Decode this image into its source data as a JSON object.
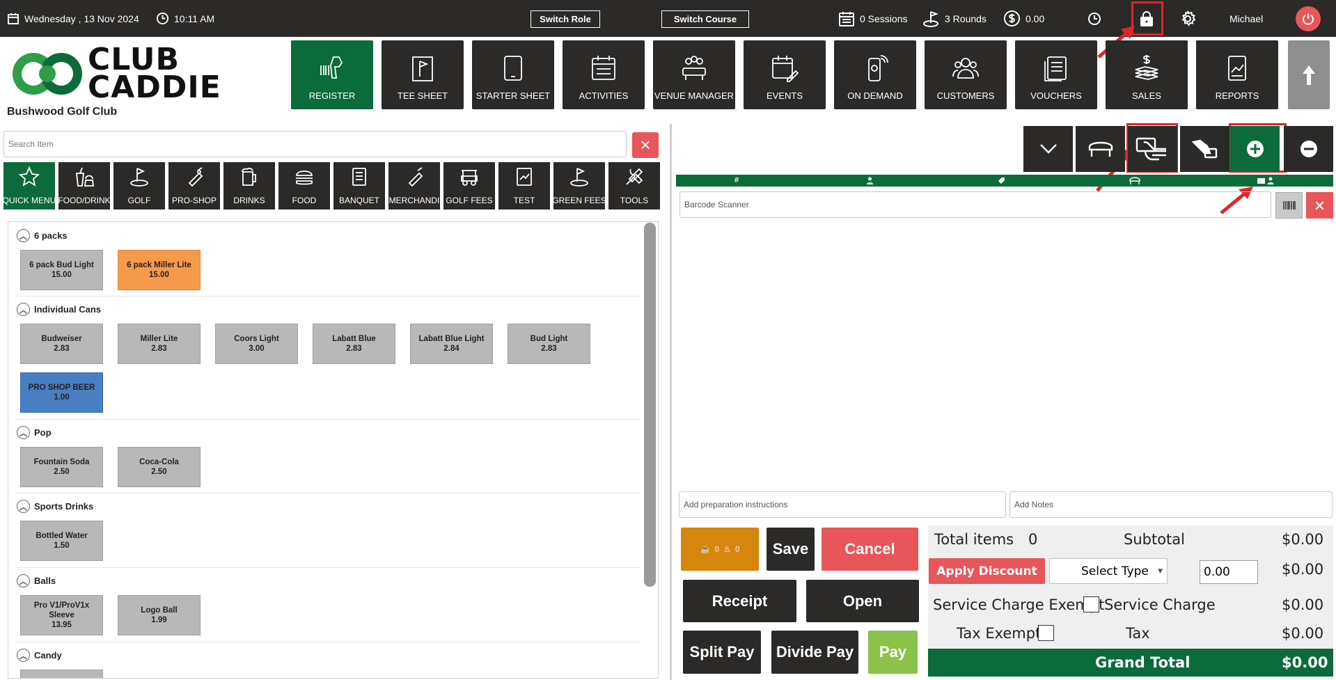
{
  "topbar": {
    "date": "Wednesday ,  13 Nov 2024",
    "time": "10:11 AM",
    "switch_role": "Switch Role",
    "switch_course": "Switch Course",
    "sessions": "0 Sessions",
    "rounds": "3 Rounds",
    "balance": "0.00",
    "user": "Michael"
  },
  "brand": {
    "line1": "CLUB",
    "line2": "CADDIE",
    "club_name": "Bushwood Golf Club"
  },
  "nav": [
    "REGISTER",
    "TEE SHEET",
    "STARTER SHEET",
    "ACTIVITIES",
    "VENUE MANAGER",
    "EVENTS",
    "ON DEMAND",
    "CUSTOMERS",
    "VOUCHERS",
    "SALES",
    "REPORTS"
  ],
  "search": {
    "placeholder": "Search Item"
  },
  "categories": [
    "QUICK MENU",
    "FOOD/DRINK",
    "GOLF",
    "PRO-SHOP",
    "DRINKS",
    "FOOD",
    "BANQUET",
    "MERCHANDI",
    "GOLF FEES",
    "TEST",
    "GREEN FEES",
    "TOOLS"
  ],
  "sections": [
    {
      "title": "6 packs",
      "items": [
        {
          "name": "6 pack Bud Light",
          "price": "15.00"
        },
        {
          "name": "6 pack Miller Lite",
          "price": "15.00"
        }
      ]
    },
    {
      "title": "Individual Cans",
      "items": [
        {
          "name": "Budweiser",
          "price": "2.83"
        },
        {
          "name": "Miller Lite",
          "price": "2.83"
        },
        {
          "name": "Coors Light",
          "price": "3.00"
        },
        {
          "name": "Labatt Blue",
          "price": "2.83"
        },
        {
          "name": "Labatt Blue Light",
          "price": "2.84"
        },
        {
          "name": "Bud Light",
          "price": "2.83"
        },
        {
          "name": "PRO SHOP BEER",
          "price": "1.00"
        }
      ]
    },
    {
      "title": "Pop",
      "items": [
        {
          "name": "Fountain Soda",
          "price": "2.50"
        },
        {
          "name": "Coca-Cola",
          "price": "2.50"
        }
      ]
    },
    {
      "title": "Sports Drinks",
      "items": [
        {
          "name": "Bottled Water",
          "price": "1.50"
        }
      ]
    },
    {
      "title": "Balls",
      "items": [
        {
          "name": "Pro V1/ProV1x Sleeve",
          "price": "13.95"
        },
        {
          "name": "Logo Ball",
          "price": "1.99"
        }
      ]
    },
    {
      "title": "Candy",
      "items": []
    }
  ],
  "colors": {
    "dark": "#2b2a28",
    "green": "#0b6b3b",
    "orange_item": "#f49a4a",
    "blue_item": "#4a7ec2",
    "red": "#e8565a",
    "highlight": "#e0242c"
  },
  "register": {
    "barcode_placeholder": "Barcode Scanner",
    "prep_placeholder": "Add preparation instructions",
    "notes_placeholder": "Add Notes",
    "counter_a": "0",
    "counter_b": "0"
  },
  "actions": {
    "save": "Save",
    "cancel": "Cancel",
    "receipt": "Receipt",
    "open": "Open",
    "split_pay": "Split Pay",
    "divide_pay": "Divide Pay",
    "pay": "Pay"
  },
  "totals": {
    "total_items_label": "Total items",
    "total_items": "0",
    "subtotal_label": "Subtotal",
    "subtotal": "$0.00",
    "apply_discount": "Apply Discount",
    "select_type": "Select Type",
    "discount_value": "0.00",
    "discount_amount": "$0.00",
    "service_charge_exempt": "Service Charge Exempt",
    "service_charge_label": "Service Charge",
    "service_charge": "$0.00",
    "tax_exempt": "Tax Exempt",
    "tax_label": "Tax",
    "tax": "$0.00",
    "grand_total_label": "Grand Total",
    "grand_total": "$0.00"
  }
}
